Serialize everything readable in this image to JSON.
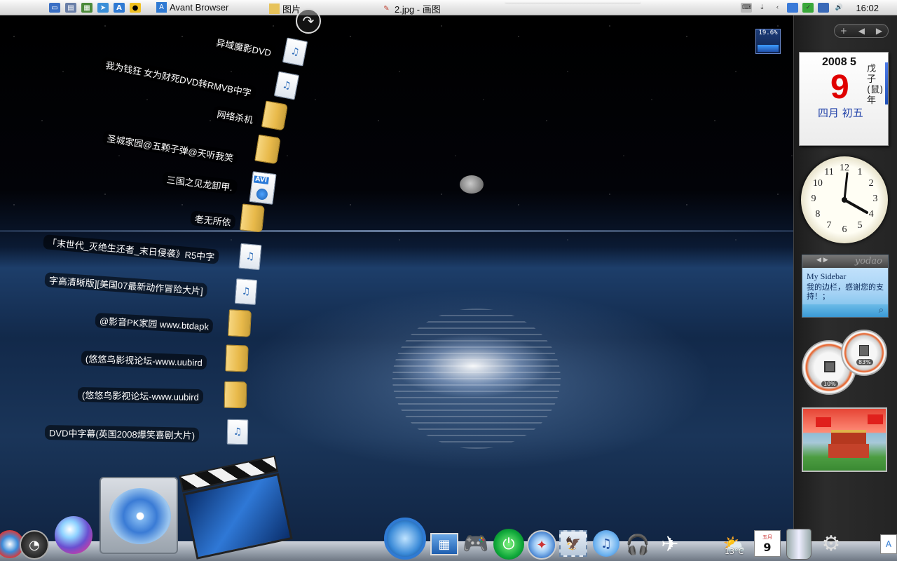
{
  "menubar": {
    "apple_glyph": "",
    "tasks": [
      {
        "label": "Avant Browser",
        "icon": "avant-icon"
      },
      {
        "label": "图片",
        "icon": "folder-icon"
      },
      {
        "label": "2.jpg - 画图",
        "icon": "paint-icon"
      }
    ],
    "time": "16:02"
  },
  "stack_items": [
    {
      "label": "异域魔影DVD",
      "type": "media"
    },
    {
      "label": "我为钱狂 女为财死DVD转RMVB中字",
      "type": "media"
    },
    {
      "label": "网络杀机",
      "type": "folder"
    },
    {
      "label": "圣城家园@五颗子弹@天听我笑",
      "type": "folder"
    },
    {
      "label": "三国之见龙卸甲.",
      "type": "avi"
    },
    {
      "label": "老无所依",
      "type": "folder"
    },
    {
      "label": "「末世代_灭绝生还者_末日侵袭》R5中字",
      "type": "media"
    },
    {
      "label": "字高清晰版][美国07最新动作冒险大片]",
      "type": "media"
    },
    {
      "label": "@影音PK家园 www.btdapk",
      "type": "folder"
    },
    {
      "label": "(悠悠鸟影视论坛-www.uubird",
      "type": "folder"
    },
    {
      "label": "(悠悠鸟影视论坛-www.uubird",
      "type": "folder"
    },
    {
      "label": "DVD中字幕(英国2008爆笑喜剧大片)",
      "type": "media"
    }
  ],
  "meter": {
    "value": "19.6%"
  },
  "sidebar": {
    "nav_add": "+",
    "nav_prev": "◀",
    "nav_next": "▶",
    "calendar": {
      "year_month": "2008 5",
      "day": "9",
      "lunar": "四月 初五",
      "ganzhi": "戊子(鼠)年"
    },
    "clock_numbers": [
      "12",
      "1",
      "2",
      "3",
      "4",
      "5",
      "6",
      "7",
      "8",
      "9",
      "10",
      "11"
    ],
    "yodao": {
      "logo": "yodao",
      "title": "My Sidebar",
      "text": "我的边栏，感谢您的支持！；"
    },
    "gauges": {
      "cpu": "10%",
      "memory": "83%"
    }
  },
  "dock": {
    "weather_temp": "13°C",
    "calendar_day": "9",
    "calendar_month": "五月"
  }
}
